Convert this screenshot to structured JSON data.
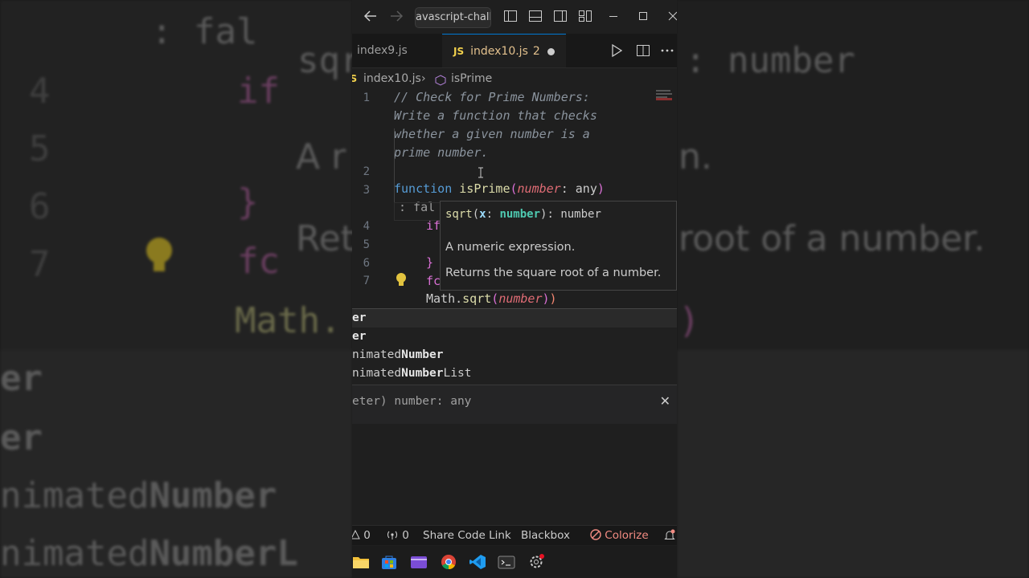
{
  "background": {
    "left_lines": [
      ": fal",
      "if",
      "A r",
      "}",
      "Ret",
      "fc",
      "Math."
    ],
    "left_line_numbers": [
      "4",
      "5",
      "6",
      "7"
    ],
    "right_lines": [
      "sqr",
      ": number",
      "n.",
      "root of a number.",
      ")"
    ],
    "suggest_lines": [
      "er",
      "er",
      "nimated",
      "Number",
      "nimated",
      "NumberL"
    ]
  },
  "titlebar": {
    "search_text": "avascript-chall"
  },
  "tabs": [
    {
      "label": "index9.js"
    },
    {
      "icon_text": "JS",
      "label": "index10.js",
      "badge": "2"
    }
  ],
  "breadcrumb": {
    "file_icon_text": "JS",
    "file": "index10.js",
    "separator": "›",
    "symbol": "isPrime"
  },
  "editor": {
    "line_numbers": [
      "1",
      "2",
      "3",
      "4",
      "5",
      "6",
      "7"
    ],
    "comment_lines": [
      "// Check for Prime Numbers:",
      "Write a function that checks",
      "whether a given number is a",
      "prime number."
    ],
    "line3": {
      "keyword": "function",
      "name": "isPrime",
      "open": "(",
      "param": "number",
      "colon": ":",
      "type": "any",
      "close": ")"
    },
    "line3_wrap": ": fal",
    "line4_frag": "if",
    "line6_frag": "}",
    "line7_frag": "fc",
    "current_line": {
      "obj": "Math",
      "dot": ".",
      "method": "sqrt",
      "open": "(",
      "arg": "number",
      "close1": ")",
      "close2": ")"
    }
  },
  "hover": {
    "sig_name": "sqrt",
    "sig_open": "(",
    "sig_param": "x",
    "sig_colon": ": ",
    "sig_type": "number",
    "sig_close": "): number",
    "param_doc": "A numeric expression.",
    "doc": "Returns the square root of a number."
  },
  "suggestions": {
    "items": [
      {
        "prefix": "",
        "match": "er",
        "suffix": ""
      },
      {
        "prefix": "",
        "match": "er",
        "suffix": ""
      },
      {
        "prefix": "nimated",
        "match": "Number",
        "suffix": ""
      },
      {
        "prefix": "nimated",
        "match": "Number",
        "suffix": "List"
      }
    ],
    "detail": "eter) number: any",
    "close": "✕"
  },
  "statusbar": {
    "errors": "0",
    "warnings": "0",
    "share": "Share Code Link",
    "blackbox": "Blackbox",
    "colorize": "Colorize"
  },
  "colors": {
    "editor_bg": "#1f1f1f",
    "accent": "#0078d4",
    "modified_tab": "#e2c08d",
    "colorize": "#f28b82"
  }
}
